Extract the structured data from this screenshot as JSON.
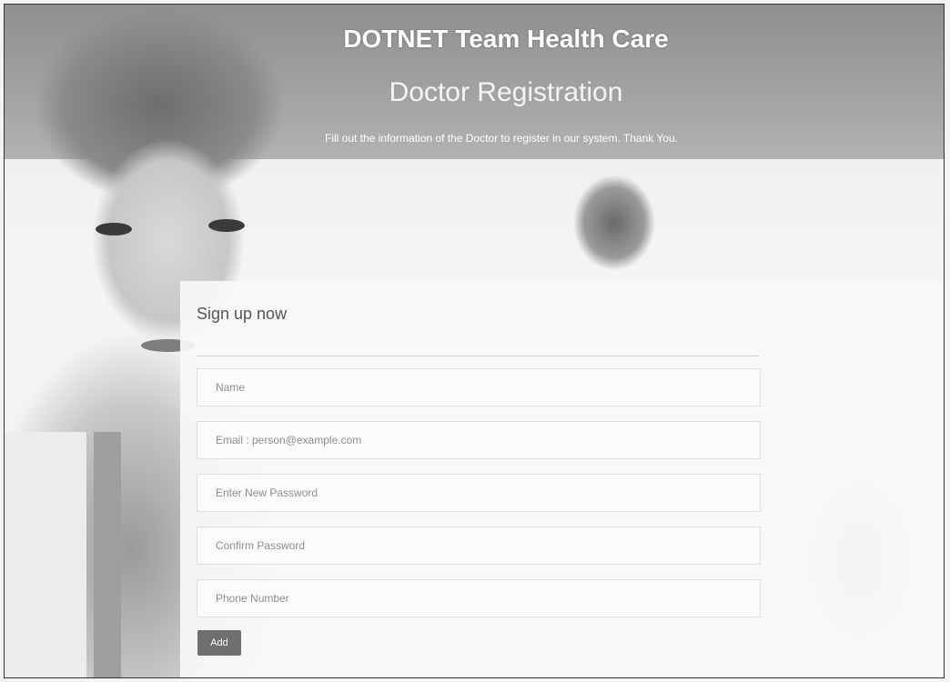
{
  "header": {
    "title": "DOTNET Team Health Care",
    "subtitle": "Doctor Registration",
    "description": "Fill out the information of the Doctor to register in our system. Thank You."
  },
  "form": {
    "heading": "Sign up now",
    "fields": [
      {
        "name": "name",
        "placeholder": "Name",
        "value": ""
      },
      {
        "name": "email",
        "placeholder": "Email : person@example.com",
        "value": ""
      },
      {
        "name": "password",
        "placeholder": "Enter New Password",
        "value": ""
      },
      {
        "name": "confirm_password",
        "placeholder": "Confirm Password",
        "value": ""
      },
      {
        "name": "phone",
        "placeholder": "Phone Number",
        "value": ""
      }
    ],
    "submit_label": "Add"
  },
  "colors": {
    "header_band": "#9a9a9a",
    "button": "#6f6f6f",
    "panel": "#f8f8f8"
  }
}
